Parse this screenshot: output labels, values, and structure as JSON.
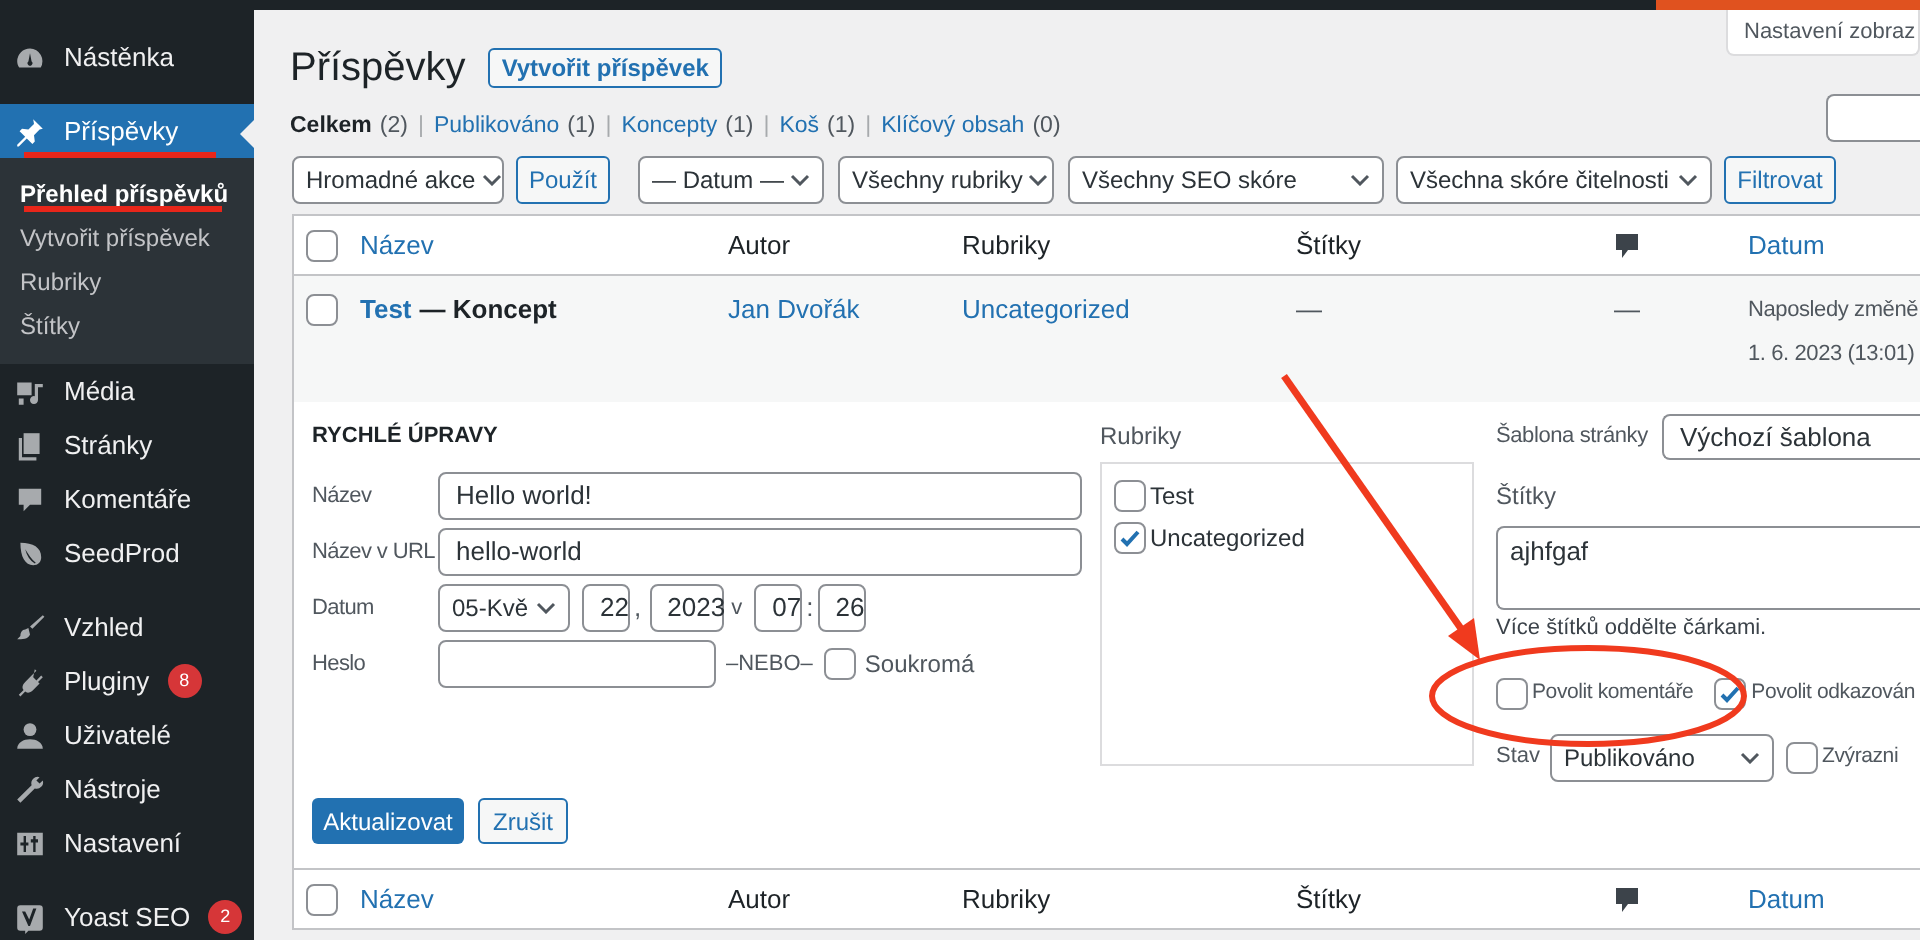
{
  "admin_bar": {
    "screen_options": "Nastavení zobraz"
  },
  "sidebar": {
    "groups": [
      [
        {
          "label": "Nástěnka",
          "selected": false
        }
      ],
      [
        {
          "label": "Příspěvky",
          "selected": true,
          "children": [
            {
              "label": "Přehled příspěvků",
              "selected": true
            },
            {
              "label": "Vytvořit příspěvek",
              "selected": false
            },
            {
              "label": "Rubriky",
              "selected": false
            },
            {
              "label": "Štítky",
              "selected": false
            }
          ]
        },
        {
          "label": "Média",
          "selected": false
        },
        {
          "label": "Stránky",
          "selected": false
        },
        {
          "label": "Komentáře",
          "selected": false
        },
        {
          "label": "SeedProd",
          "selected": false
        }
      ],
      [
        {
          "label": "Vzhled",
          "selected": false
        },
        {
          "label": "Pluginy",
          "selected": false,
          "badge": "8"
        },
        {
          "label": "Uživatelé",
          "selected": false
        },
        {
          "label": "Nástroje",
          "selected": false
        },
        {
          "label": "Nastavení",
          "selected": false
        }
      ],
      [
        {
          "label": "Yoast SEO",
          "selected": false,
          "badge": "2"
        }
      ]
    ]
  },
  "page": {
    "title": "Příspěvky",
    "add_button": "Vytvořit příspěvek"
  },
  "status_filters": [
    {
      "label": "Celkem",
      "count": "(2)",
      "selected": true
    },
    {
      "separator": "|",
      "label": "Publikováno",
      "count": "(1)",
      "selected": false
    },
    {
      "separator": "|",
      "label": "Koncepty",
      "count": "(1)",
      "selected": false
    },
    {
      "separator": "|",
      "label": "Koš",
      "count": "(1)",
      "selected": false
    },
    {
      "separator": "|",
      "label": "Klíčový obsah",
      "count": "(0)",
      "selected": false
    }
  ],
  "filters": {
    "bulk_action": "Hromadné akce",
    "apply": "Použít",
    "selects": [
      "— Datum —",
      "Všechny rubriky",
      "Všechny SEO skóre",
      "Všechna skóre čitelnosti"
    ],
    "filter_button": "Filtrovat"
  },
  "table": {
    "select_all_checked": false,
    "columns": [
      {
        "kind": "text",
        "label": "Název",
        "sortable": true
      },
      {
        "kind": "text",
        "label": "Autor",
        "sortable": false
      },
      {
        "kind": "text",
        "label": "Rubriky",
        "sortable": false
      },
      {
        "kind": "text",
        "label": "Štítky",
        "sortable": false
      },
      {
        "kind": "icon",
        "sortable": false
      },
      {
        "kind": "text",
        "label": "Datum",
        "sortable": true
      }
    ],
    "rows": [
      {
        "checked": false,
        "title": "Test",
        "state": "— Koncept",
        "author": "Jan Dvořák",
        "category": "Uncategorized",
        "tags": "—",
        "comments": "—",
        "date": [
          "Naposledy změně",
          "1. 6. 2023 (13:01)"
        ]
      }
    ],
    "quick_edit": {
      "heading": "RYCHLÉ ÚPRAVY",
      "fields": [
        {
          "label": "Název",
          "value": "Hello world!"
        },
        {
          "label": "Název v URL",
          "value": "hello-world"
        }
      ],
      "date": {
        "label": "Datum",
        "month": "05-Kvě",
        "day": "22",
        "comma": ",",
        "year": "2023",
        "at": "v",
        "hour": "07",
        "colon": ":",
        "minute": "26"
      },
      "password": {
        "label": "Heslo",
        "or": "–NEBO–",
        "private_label": "Soukromá",
        "private_checked": false
      },
      "categories": {
        "label": "Rubriky",
        "items": [
          {
            "label": "Test",
            "checked": false
          },
          {
            "label": "Uncategorized",
            "checked": true
          }
        ]
      },
      "template": {
        "label": "Šablona stránky",
        "value": "Výchozí šablona"
      },
      "tags": {
        "label": "Štítky",
        "value": "ajhfgaf",
        "hint": "Více štítků oddělte čárkami."
      },
      "options": [
        {
          "label": "Povolit komentáře",
          "checked": false
        },
        {
          "label": "Povolit odkazován",
          "checked": true
        }
      ],
      "status": {
        "label": "Stav",
        "value": "Publikováno"
      },
      "sticky": {
        "label": "Zvýrazni",
        "checked": false
      },
      "buttons": {
        "update": "Aktualizovat",
        "cancel": "Zrušit"
      }
    },
    "footer_columns": [
      {
        "kind": "text",
        "label": "Název",
        "sortable": true
      },
      {
        "kind": "text",
        "label": "Autor",
        "sortable": false
      },
      {
        "kind": "text",
        "label": "Rubriky",
        "sortable": false
      },
      {
        "kind": "text",
        "label": "Štítky",
        "sortable": false
      },
      {
        "kind": "icon",
        "sortable": false
      },
      {
        "kind": "text",
        "label": "Datum",
        "sortable": true
      }
    ],
    "footer_select_all_checked": false
  }
}
